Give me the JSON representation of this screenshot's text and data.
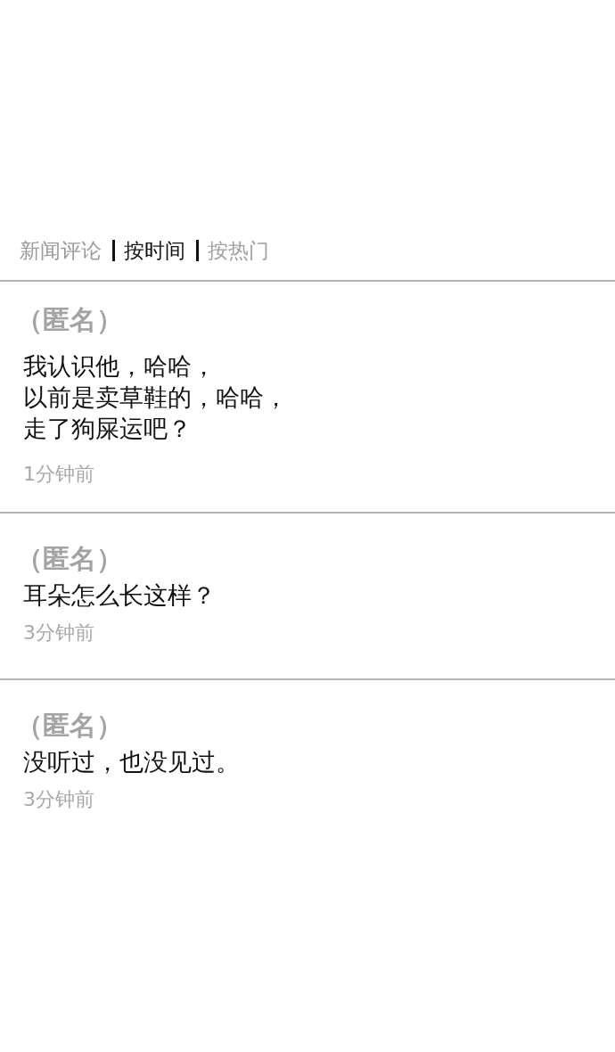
{
  "header": {
    "title": "新闻评论",
    "sort_tabs": [
      {
        "label": "按时间",
        "selected": true
      },
      {
        "label": "按热门",
        "selected": false
      }
    ]
  },
  "comments": [
    {
      "author": "（匿名）",
      "lines": [
        "我认识他，哈哈，",
        "以前是卖草鞋的，哈哈，",
        "走了狗屎运吧？"
      ],
      "time": "1分钟前"
    },
    {
      "author": "（匿名）",
      "lines": [
        "耳朵怎么长这样？"
      ],
      "time": "3分钟前"
    },
    {
      "author": "（匿名）",
      "lines": [
        "没听过，也没见过。"
      ],
      "time": "3分钟前"
    }
  ]
}
